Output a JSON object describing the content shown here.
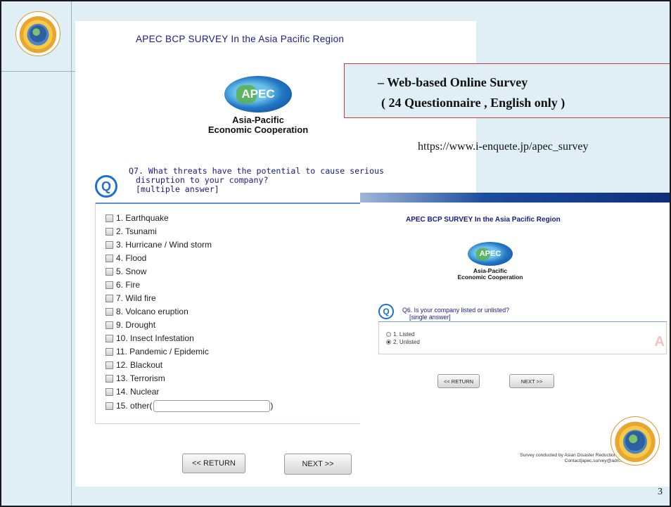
{
  "main_survey": {
    "title": "APEC BCP SURVEY In the Asia Pacific Region",
    "apec_logo": {
      "acronym": "APEC",
      "line1": "Asia-Pacific",
      "line2": "Economic Cooperation"
    },
    "question": {
      "icon": "Q",
      "line1": "Q7. What threats have the potential to cause serious",
      "line2": "disruption to your company?",
      "line3": "[multiple answer]"
    },
    "options": [
      "1.  Earthquake",
      "2.  Tsunami",
      "3.  Hurricane / Wind storm",
      "4.  Flood",
      "5.  Snow",
      "6.  Fire",
      "7.  Wild fire",
      "8.  Volcano eruption",
      "9.  Drought",
      "10. Insect Infestation",
      "11.  Pandemic / Epidemic",
      "12.  Blackout",
      "13.  Terrorism",
      "14.  Nuclear",
      "15.  other("
    ],
    "other_close": ")",
    "return_label": "<< RETURN",
    "next_label": "NEXT >>"
  },
  "callout": {
    "line1": "–  Web-based  Online Survey",
    "line2": "( 24 Questionnaire , English only )"
  },
  "url": "https://www.i-enquete.jp/apec_survey",
  "second_survey": {
    "title": "APEC BCP SURVEY In the Asia Pacific Region",
    "apec_logo": {
      "acronym": "APEC",
      "line1": "Asia-Pacific",
      "line2": "Economic Cooperation"
    },
    "question": {
      "icon": "Q",
      "line1": "Q6. Is your company listed or unlisted?",
      "line2": "[single answer]"
    },
    "options": [
      {
        "label": "1.  Listed",
        "selected": false
      },
      {
        "label": "2.  Unlisted",
        "selected": true
      }
    ],
    "watermark": "A",
    "return_label": "<< RETURN",
    "next_label": "NEXT >>",
    "credit_line1": "Survey conducted by Asian Disaster Reduction Center",
    "credit_line2": "Contact[apec.survey@adrc.asia]"
  },
  "page_number": "3",
  "logo": {
    "icon": "adrc-logo-icon",
    "text": "ASIAN DISASTER REDUCTION CENTER"
  },
  "colors": {
    "slide_bg": "#e0eef6",
    "title_navy": "#1a1a8c",
    "question_blue": "#1d6fd0",
    "callout_border": "#d43a3a"
  }
}
